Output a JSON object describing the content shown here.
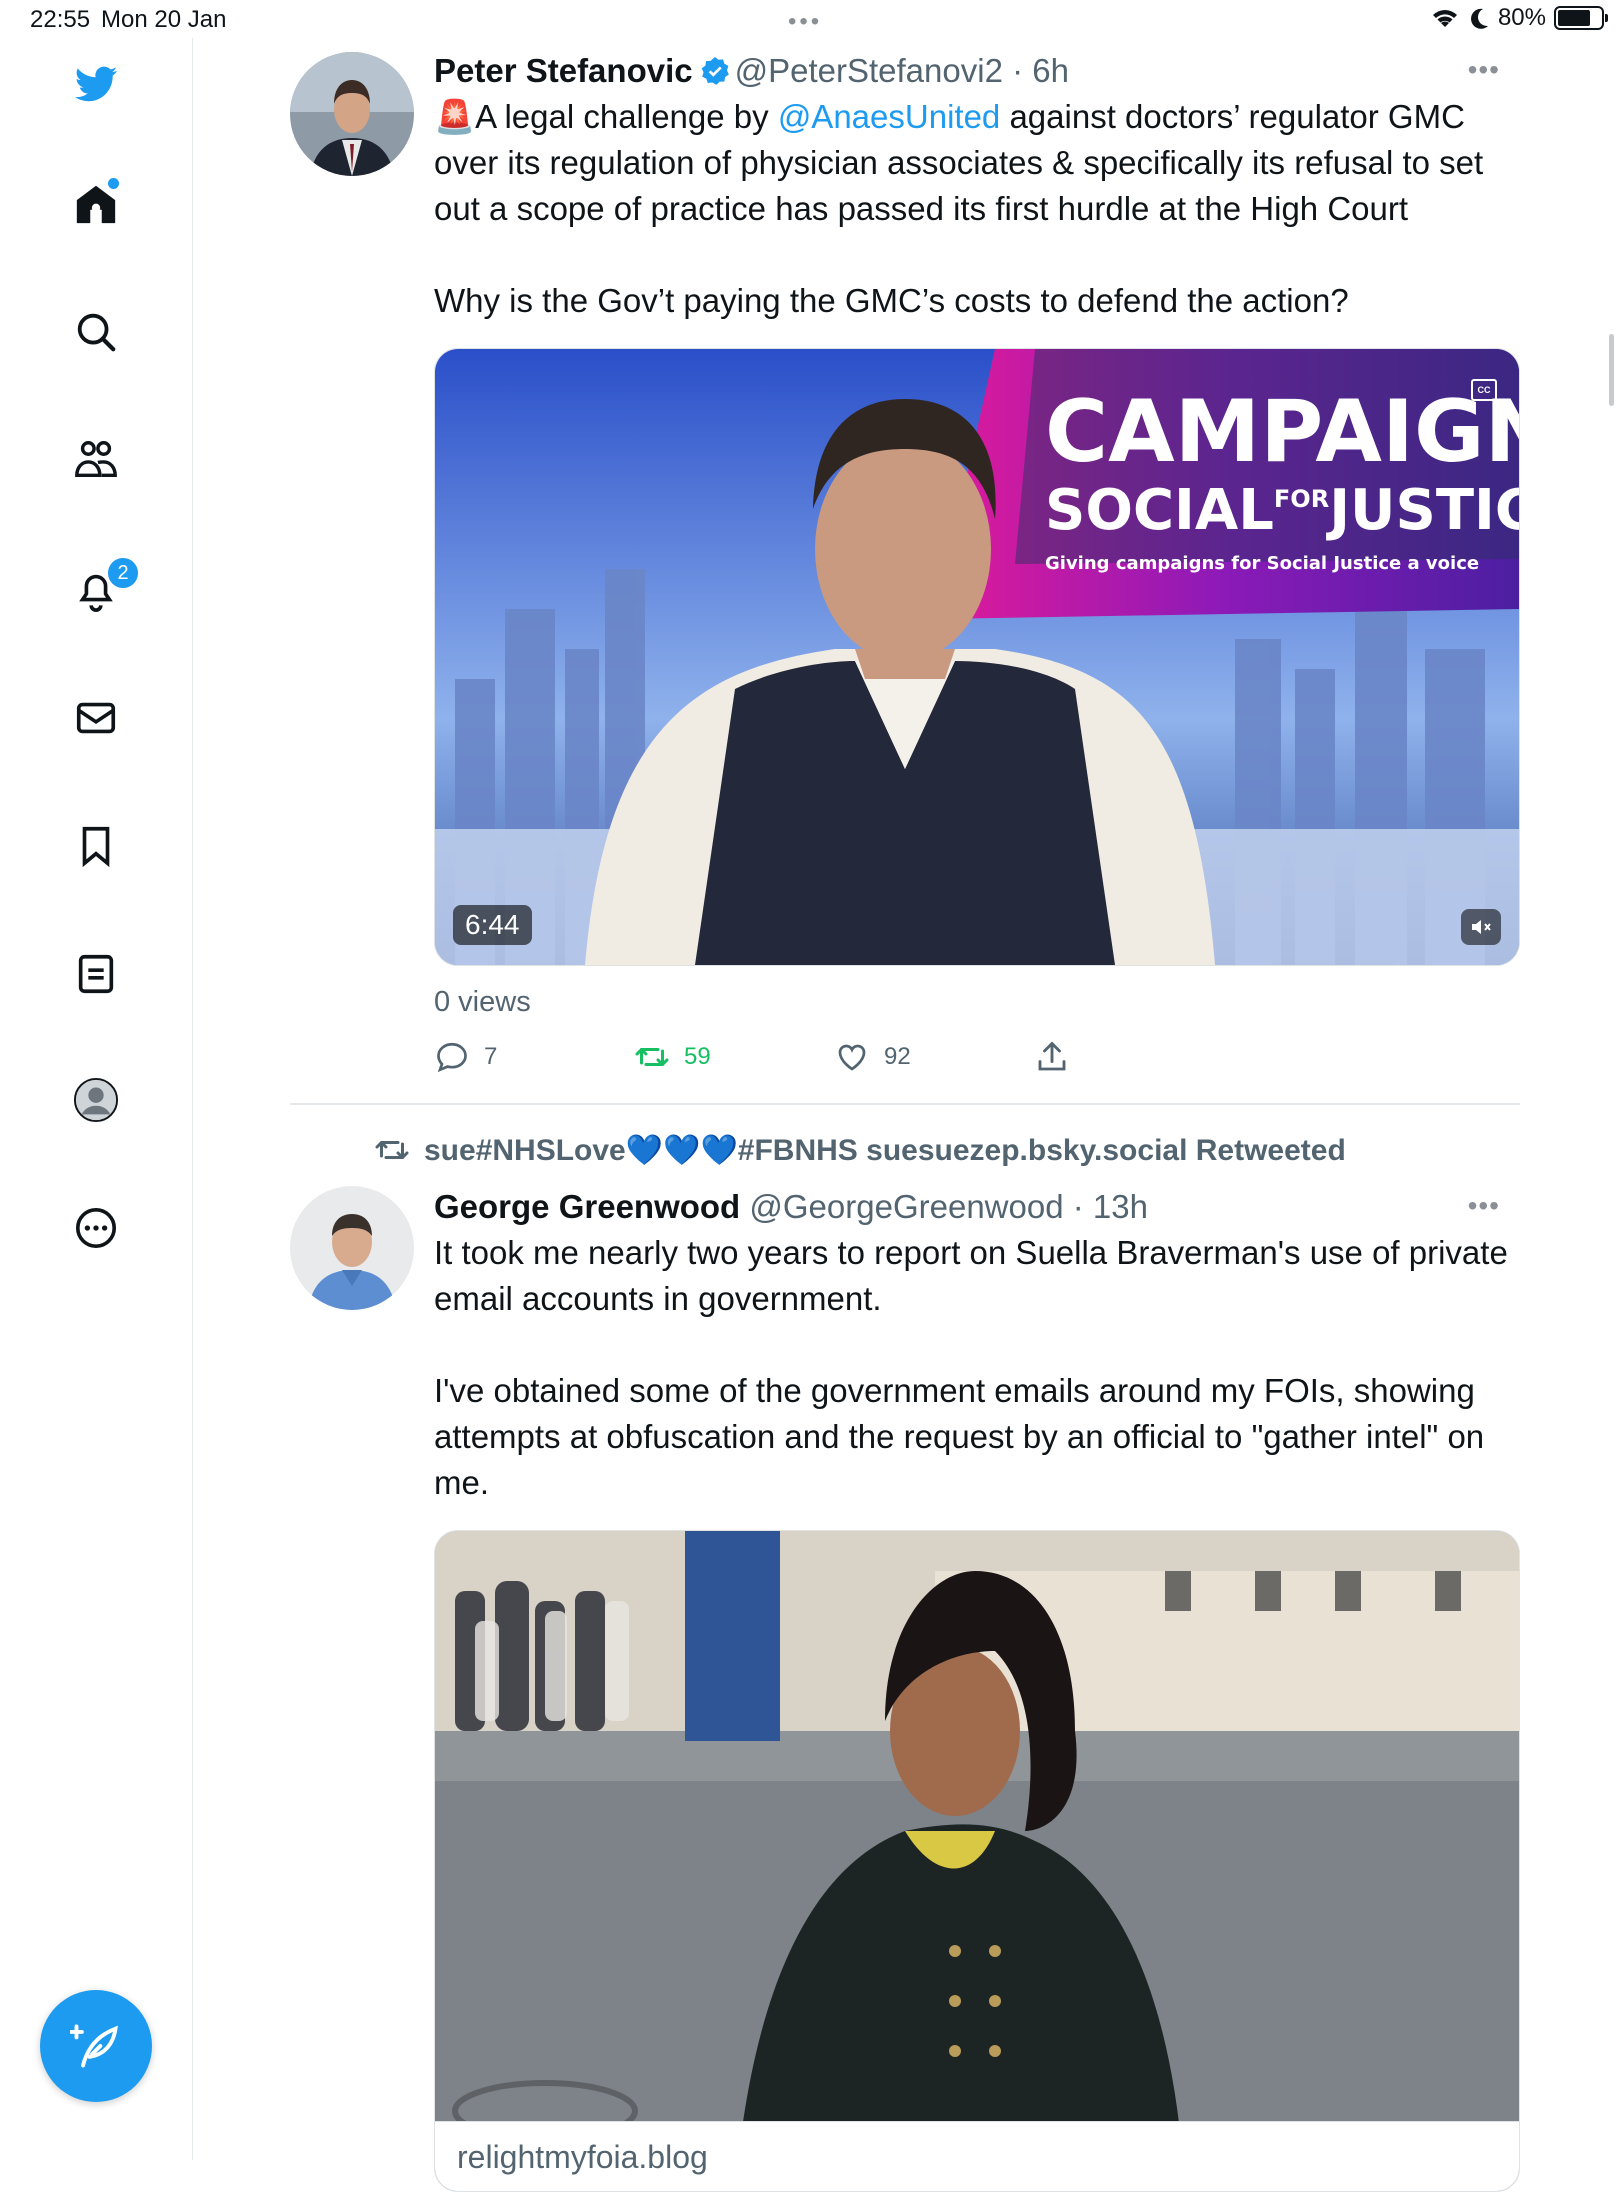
{
  "status_bar": {
    "time": "22:55",
    "date": "Mon 20 Jan",
    "battery": "80%"
  },
  "sidebar": {
    "items": [
      {
        "icon": "twitter-bird-icon"
      },
      {
        "icon": "home-icon"
      },
      {
        "icon": "search-icon"
      },
      {
        "icon": "communities-icon"
      },
      {
        "icon": "notifications-bell-icon",
        "badge": "2"
      },
      {
        "icon": "messages-envelope-icon"
      },
      {
        "icon": "bookmark-icon"
      },
      {
        "icon": "lists-icon"
      },
      {
        "icon": "profile-avatar-icon"
      },
      {
        "icon": "more-circle-icon"
      }
    ],
    "compose_icon": "compose-feather-icon"
  },
  "colors": {
    "accent": "#1d9bf0",
    "retweet_green": "#17bf63",
    "secondary_text": "#536471"
  },
  "tweets": [
    {
      "name": "Peter Stefanovic",
      "handle": "@PeterStefanovi2",
      "time": "6h",
      "text_lines": {
        "p1_pre": "🚨A legal challenge by ",
        "p1_link": "@AnaesUnited",
        "p1_post": " against doctors’ regulator GMC over its regulation of physician associates & specifically its refusal to set out a scope of practice has passed its first hurdle at the High Court",
        "p2": "Why is the Gov’t paying the GMC’s costs to defend the action?"
      },
      "video": {
        "duration": "6:44",
        "overlay_title": "CAMPAIGN",
        "overlay_subtitle_left": "SOCIAL",
        "overlay_subtitle_for": "FOR",
        "overlay_subtitle_right": "JUSTICE",
        "overlay_tagline": "Giving campaigns for Social Justice a voice",
        "cc_label": "CC"
      },
      "views": "0 views",
      "replies": "7",
      "retweets": "59",
      "likes": "92"
    },
    {
      "retweeted_by": "sue#NHSLove💙💙💙#FBNHS suesuezep.bsky.social Retweeted",
      "name": "George Greenwood",
      "handle": "@GeorgeGreenwood",
      "time": "13h",
      "text_lines": {
        "p1": "It took me nearly two years to report on Suella Braverman's use of private email accounts in government.",
        "p2": "I've obtained some of the government emails around my FOIs, showing attempts at obfuscation and the request by an official to \"gather intel\" on me."
      },
      "card_domain": "relightmyfoia.blog"
    }
  ]
}
